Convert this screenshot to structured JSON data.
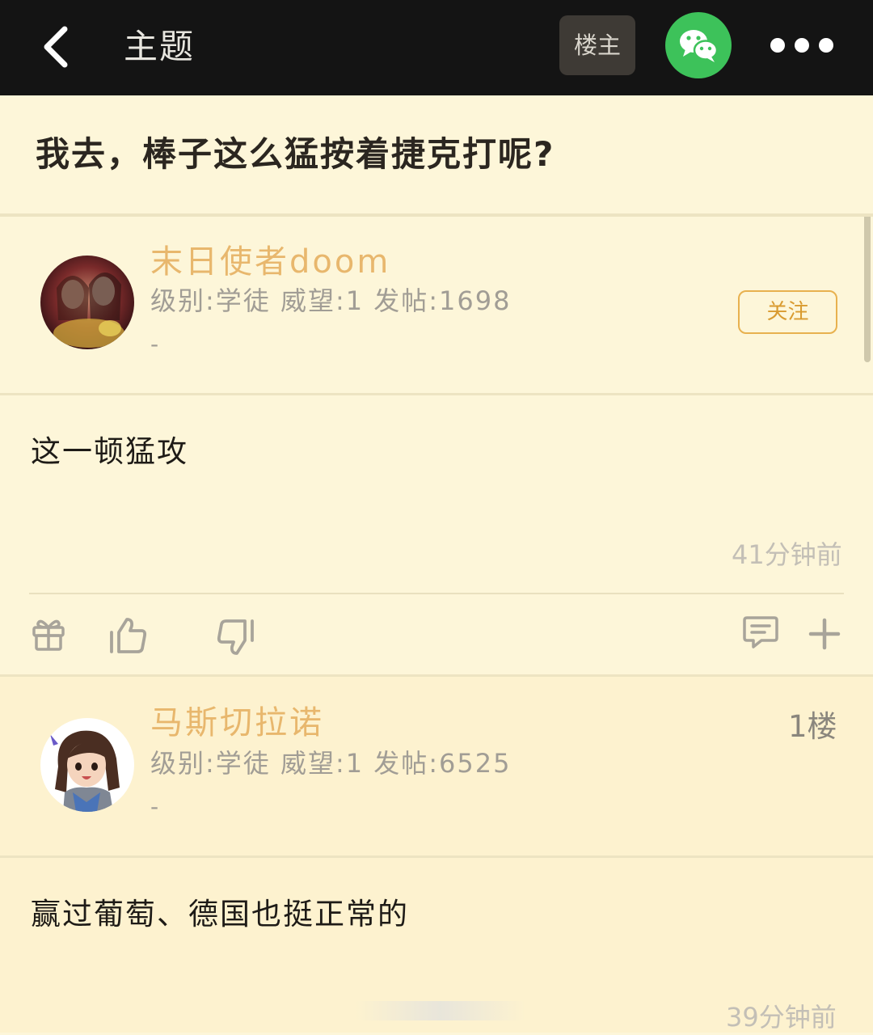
{
  "header": {
    "title": "主题",
    "op_button": "楼主",
    "icons": [
      "back-arrow-icon",
      "wechat-icon",
      "more-dots-icon"
    ]
  },
  "post": {
    "title": "我去，棒子这么猛按着捷克打呢?",
    "author": {
      "name": "末日使者doom",
      "info": "级别:学徒 威望:1 发帖:1698",
      "signature": "-"
    },
    "follow_label": "关注",
    "content": "这一顿猛攻",
    "time": "41分钟前",
    "actions": [
      "gift-icon",
      "thumbs-up-icon",
      "thumbs-down-icon",
      "comment-icon",
      "plus-icon"
    ]
  },
  "reply": {
    "author": {
      "name": "马斯切拉诺",
      "info": "级别:学徒 威望:1 发帖:6525",
      "signature": "-"
    },
    "floor": "1楼",
    "content": "赢过葡萄、德国也挺正常的",
    "time": "39分钟前"
  },
  "colors": {
    "background": "#fdf6d9",
    "reply_background": "#fdf2cf",
    "header": "#141414",
    "username": "#e8b76d",
    "follow_accent": "#e8b14f",
    "wechat_green": "#3dc25a"
  }
}
